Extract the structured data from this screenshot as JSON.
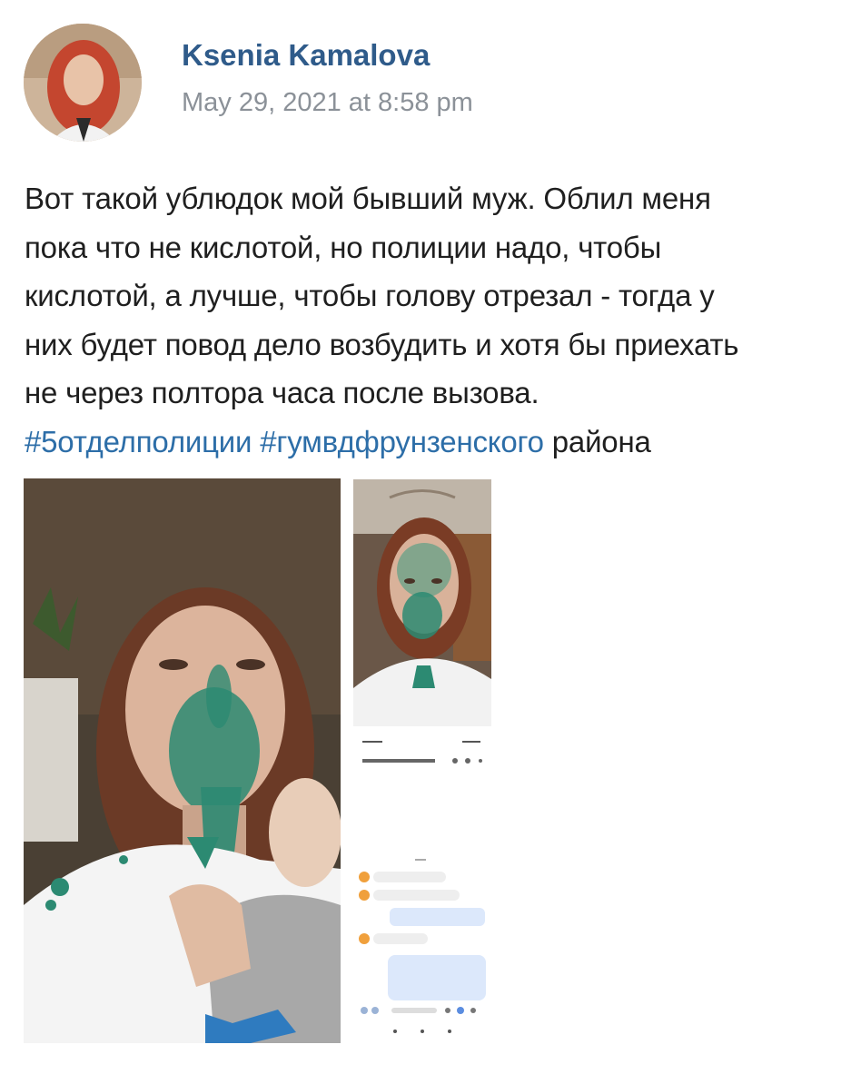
{
  "post": {
    "author_name": "Ksenia Kamalova",
    "date": "May 29, 2021 at 8:58 pm",
    "text_lines": [
      "Вот такой ублюдок мой бывший муж. Облил меня",
      "пока что не кислотой, но полиции надо, чтобы",
      "кислотой, а лучше, чтобы голову отрезал - тогда у",
      "них будет повод дело возбудить и хотя бы приехать",
      "не через полтора часа после вызова."
    ],
    "hashtag_1": "#5отделполиции",
    "hashtag_2": "#гумвдфрунзенского",
    "text_tail": "района"
  },
  "colors": {
    "author": "#2f5b8a",
    "hashtag": "#2d6ea8",
    "date": "#8b9198",
    "text": "#1f1f1f",
    "green_paint": "#2c8a72"
  },
  "icons": {
    "avatar": "avatar-photo",
    "photo_1": "photo-woman-green-face",
    "photo_2": "photo-woman-green-face-close",
    "photo_3": "photo-phone-screenshot-messages"
  }
}
